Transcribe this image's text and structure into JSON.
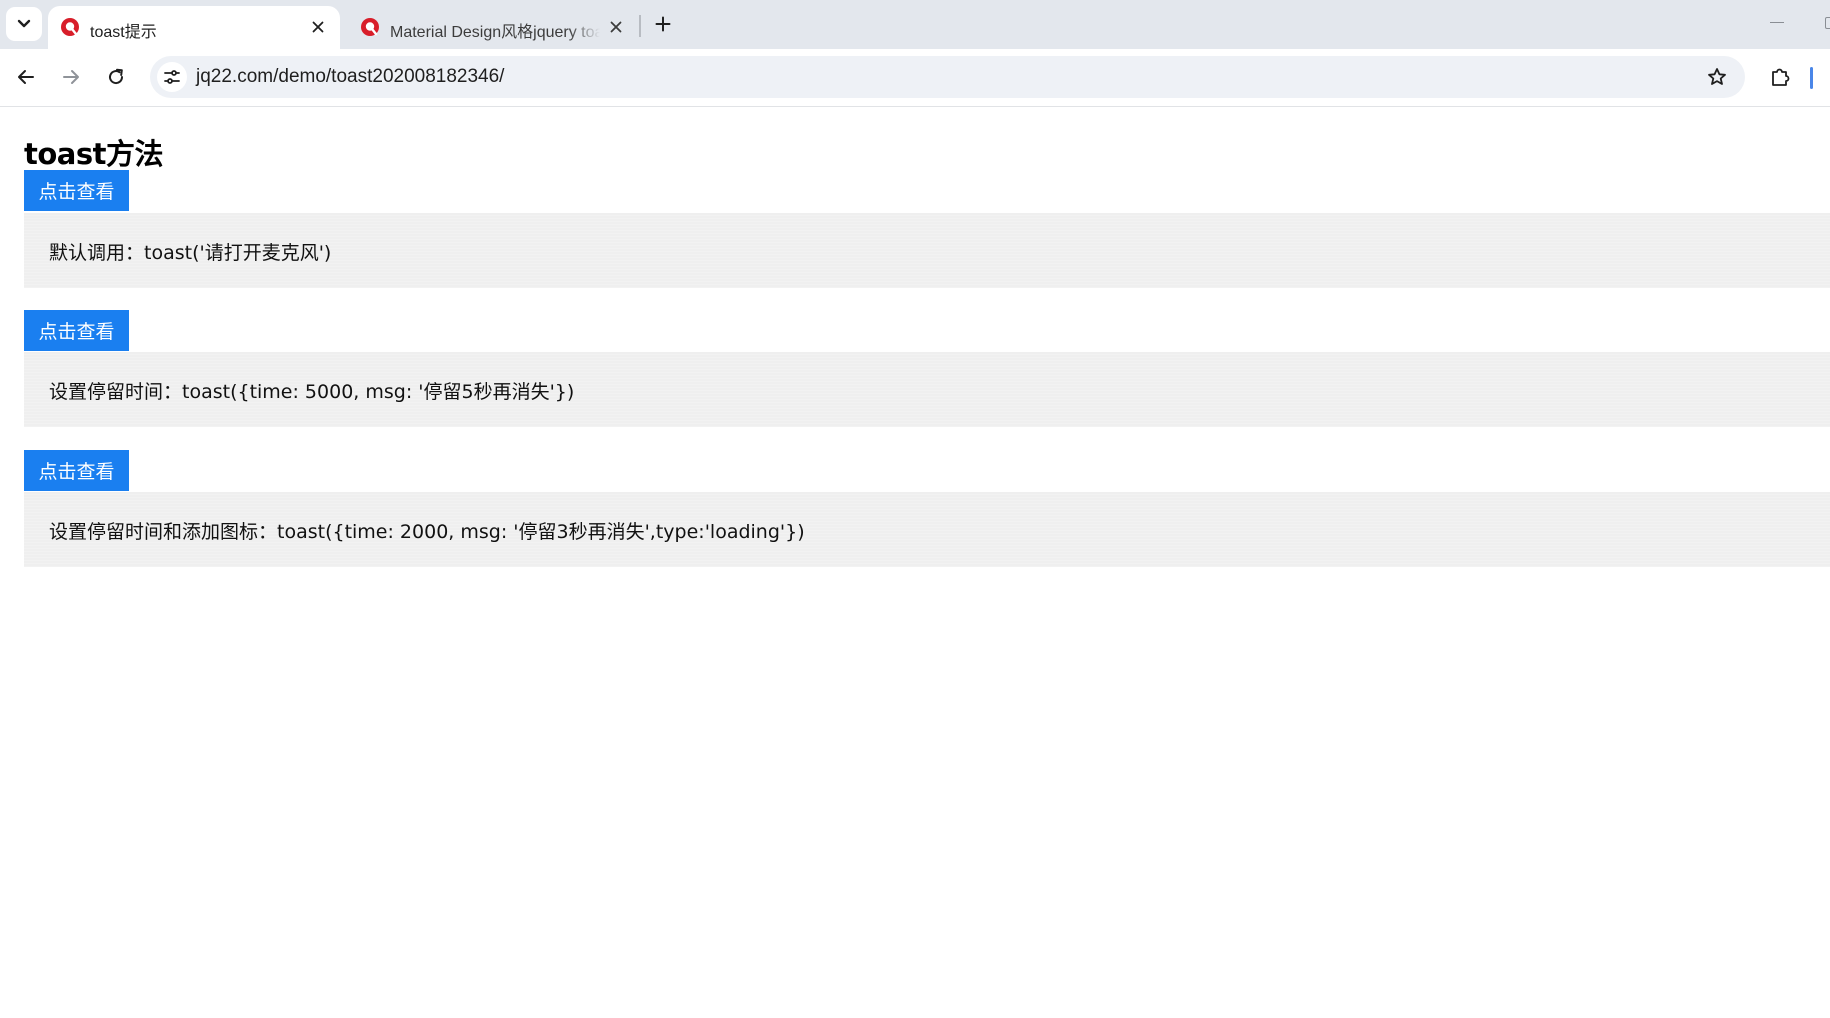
{
  "browser": {
    "tabs": [
      {
        "title": "toast提示",
        "active": true
      },
      {
        "title": "Material Design风格jquery toast",
        "active": false
      }
    ],
    "url": "jq22.com/demo/toast202008182346/",
    "accent_color": "#1a7ff0"
  },
  "page": {
    "title": "toast方法",
    "demos": [
      {
        "button_label": "点击查看",
        "description": "默认调用：toast('请打开麦克风')"
      },
      {
        "button_label": "点击查看",
        "description": "设置停留时间：toast({time: 5000, msg: '停留5秒再消失'})"
      },
      {
        "button_label": "点击查看",
        "description": "设置停留时间和添加图标：toast({time: 2000, msg: '停留3秒再消失',type:'loading'})"
      }
    ]
  }
}
